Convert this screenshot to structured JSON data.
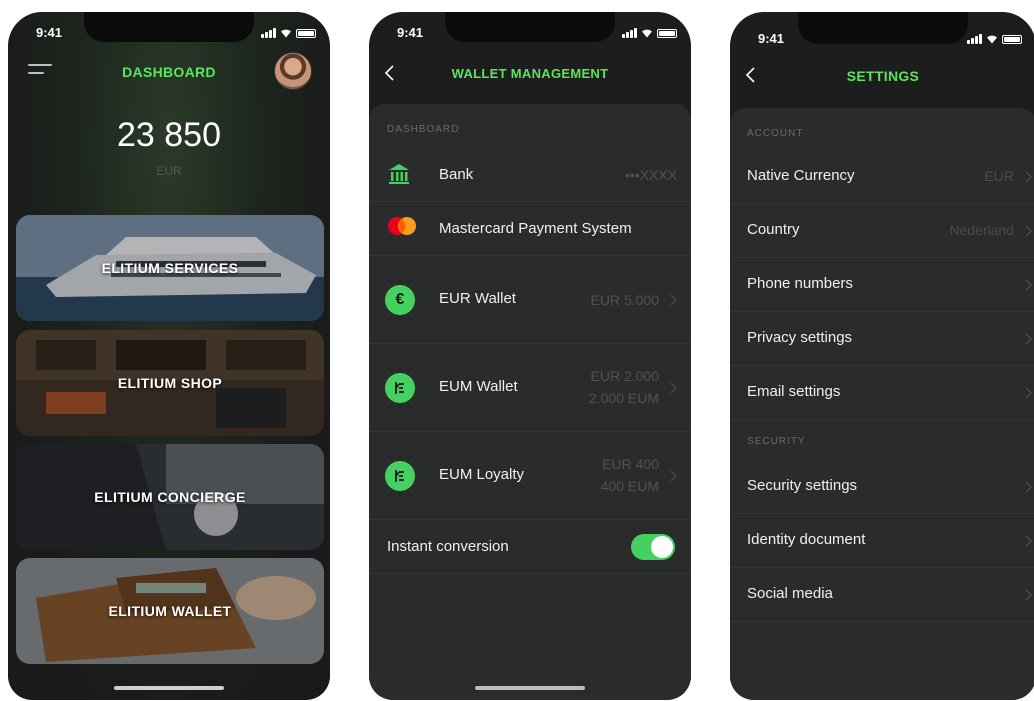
{
  "status_time": "9:41",
  "accent_color": "#5de35d",
  "dashboard": {
    "title": "DASHBOARD",
    "balance": "23 850",
    "currency": "EUR",
    "cards": [
      {
        "label": "ELITIUM SERVICES"
      },
      {
        "label": "ELITIUM SHOP"
      },
      {
        "label": "ELITIUM CONCIERGE"
      },
      {
        "label": "ELITIUM WALLET"
      }
    ]
  },
  "wallet": {
    "title": "WALLET MANAGEMENT",
    "section": "DASHBOARD",
    "bank": {
      "label": "Bank",
      "value": "•••XXXX"
    },
    "mastercard": {
      "label": "Mastercard Payment System",
      "logo_text": "mastercard"
    },
    "eur_wallet": {
      "label": "EUR Wallet",
      "value": "EUR 5.000",
      "icon": "€"
    },
    "eum_wallet": {
      "label": "EUM Wallet",
      "value1": "EUR 2.000",
      "value2": "2.000 EUM"
    },
    "eum_loyalty": {
      "label": "EUM Loyalty",
      "value1": "EUR 400",
      "value2": "400 EUM"
    },
    "instant": {
      "label": "Instant conversion",
      "enabled": true
    }
  },
  "settings": {
    "title": "SETTINGS",
    "account_header": "ACCOUNT",
    "security_header": "SECURITY",
    "account_items": [
      {
        "label": "Native Currency",
        "value": "EUR"
      },
      {
        "label": "Country",
        "value": "Nederland"
      },
      {
        "label": "Phone numbers",
        "value": ""
      },
      {
        "label": "Privacy settings",
        "value": ""
      },
      {
        "label": "Email settings",
        "value": ""
      }
    ],
    "security_items": [
      {
        "label": "Security settings"
      },
      {
        "label": "Identity document"
      },
      {
        "label": "Social media"
      }
    ]
  }
}
